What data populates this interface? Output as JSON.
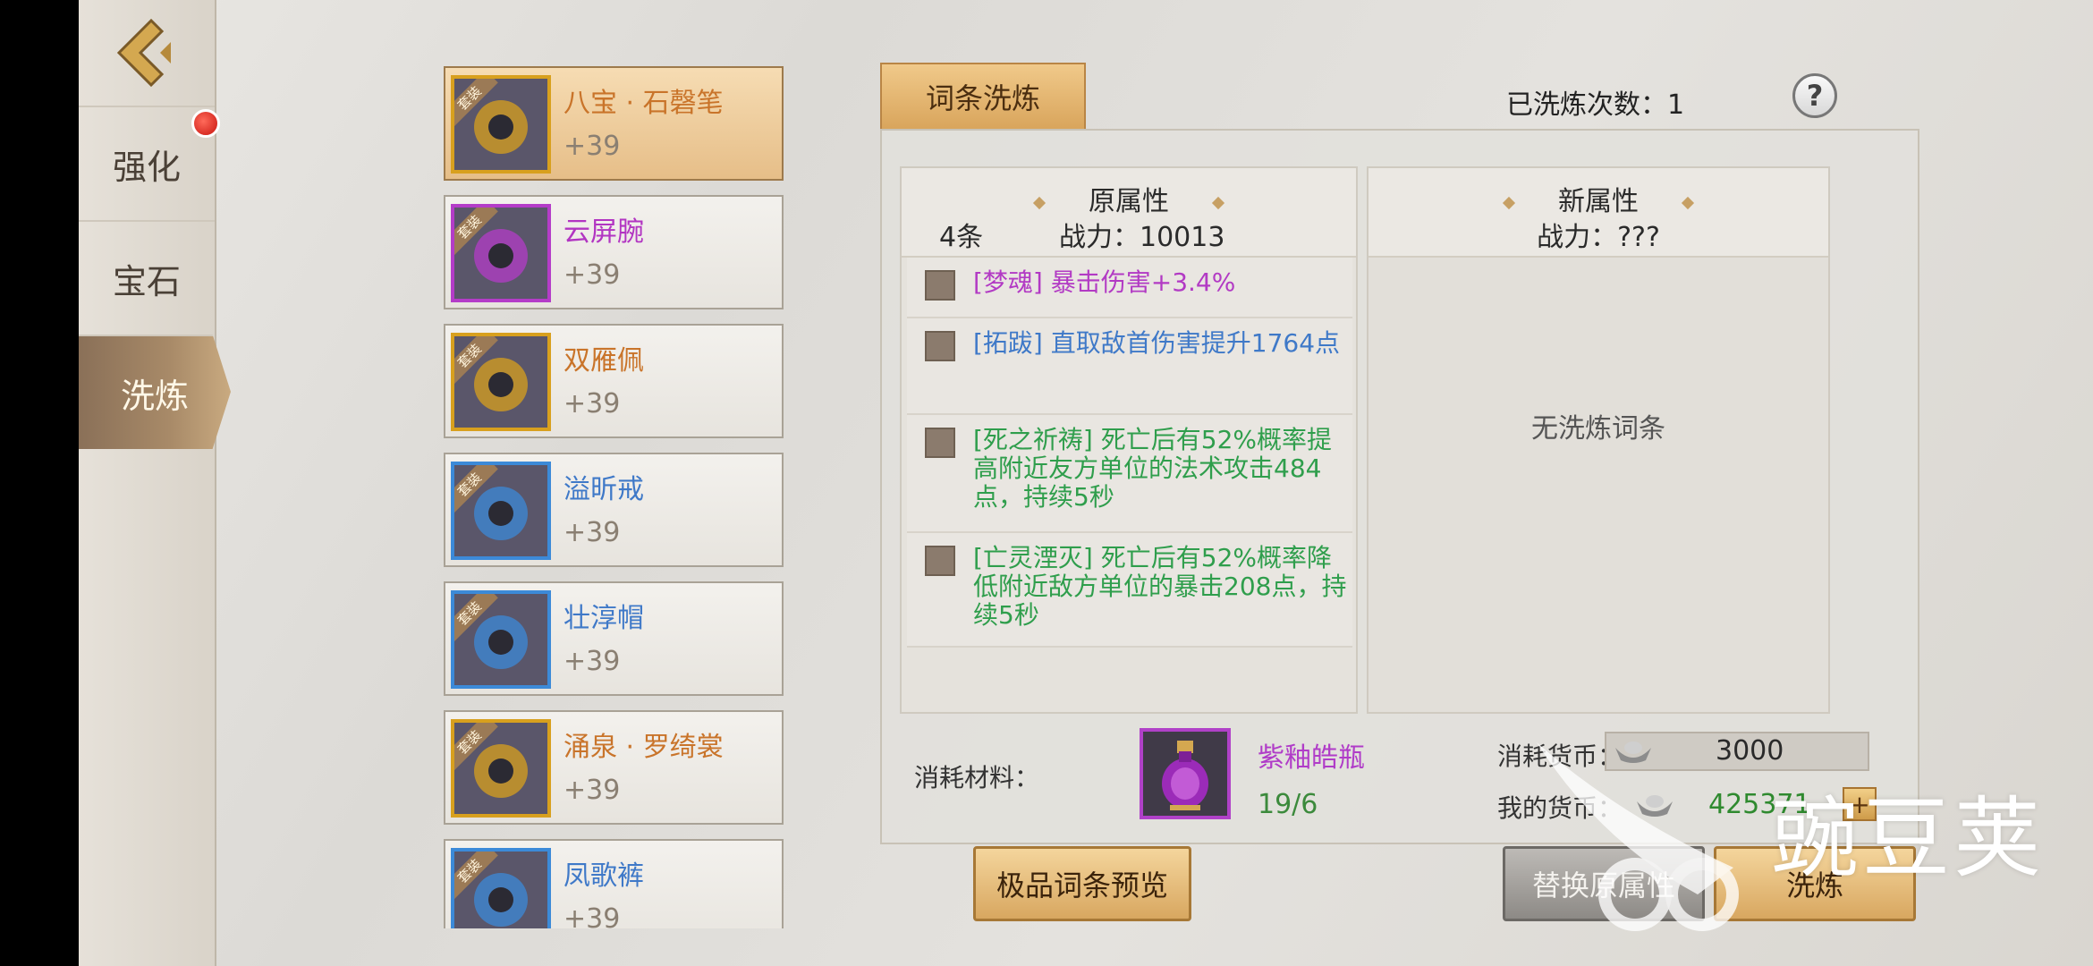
{
  "nav": {
    "tabs": [
      {
        "label": "强化",
        "badge": true
      },
      {
        "label": "宝石"
      },
      {
        "label": "洗炼",
        "active": true
      }
    ]
  },
  "equipment": [
    {
      "tag": "套装",
      "name": "八宝 · 石磬笔",
      "level": "+39",
      "name_color": "#c9742a",
      "frame_color": "#d8a01e",
      "selected": true
    },
    {
      "tag": "套装",
      "name": "云屏腕",
      "level": "+39",
      "name_color": "#b235c2",
      "frame_color": "#b43cc8"
    },
    {
      "tag": "套装",
      "name": "双雁佩",
      "level": "+39",
      "name_color": "#c9742a",
      "frame_color": "#d8a01e"
    },
    {
      "tag": "套装",
      "name": "溢昕戒",
      "level": "+39",
      "name_color": "#3f79c8",
      "frame_color": "#3c8ad8"
    },
    {
      "tag": "套装",
      "name": "壮淳帽",
      "level": "+39",
      "name_color": "#3f79c8",
      "frame_color": "#3c8ad8"
    },
    {
      "tag": "套装",
      "name": "涌泉 · 罗绮裳",
      "level": "+39",
      "name_color": "#c9742a",
      "frame_color": "#d8a01e"
    },
    {
      "tag": "套装",
      "name": "凤歌裤",
      "level": "+39",
      "name_color": "#3f79c8",
      "frame_color": "#3c8ad8"
    }
  ],
  "panel": {
    "tab_label": "词条洗炼",
    "refine_count": "已洗炼次数：1",
    "help": "?"
  },
  "original": {
    "title": "原属性",
    "count": "4条",
    "power": "战力：10013",
    "attrs": [
      {
        "text": "[梦魂]  暴击伤害+3.4%",
        "color": "#b23ac4"
      },
      {
        "text": "[拓跋]  直取敌首伤害提升1764点",
        "color": "#3f79c8"
      },
      {
        "text": "[死之祈祷]  死亡后有52%概率提高附近友方单位的法术攻击484点，持续5秒",
        "color": "#2f9e4c"
      },
      {
        "text": "[亡灵湮灭]  死亡后有52%概率降低附近敌方单位的暴击208点，持续5秒",
        "color": "#2f9e4c"
      }
    ]
  },
  "new": {
    "title": "新属性",
    "power": "战力：???",
    "empty": "无洗炼词条"
  },
  "cost": {
    "material_label": "消耗材料：",
    "material_name": "紫釉皓瓶",
    "material_count": "19/6",
    "currency_label": "消耗货币：",
    "currency_value": "3000",
    "my_label": "我的货币：",
    "my_value": "425371"
  },
  "buttons": {
    "preview": "极品词条预览",
    "keep": "替换原属性",
    "refine": "洗炼"
  },
  "watermark": "豌豆荚"
}
